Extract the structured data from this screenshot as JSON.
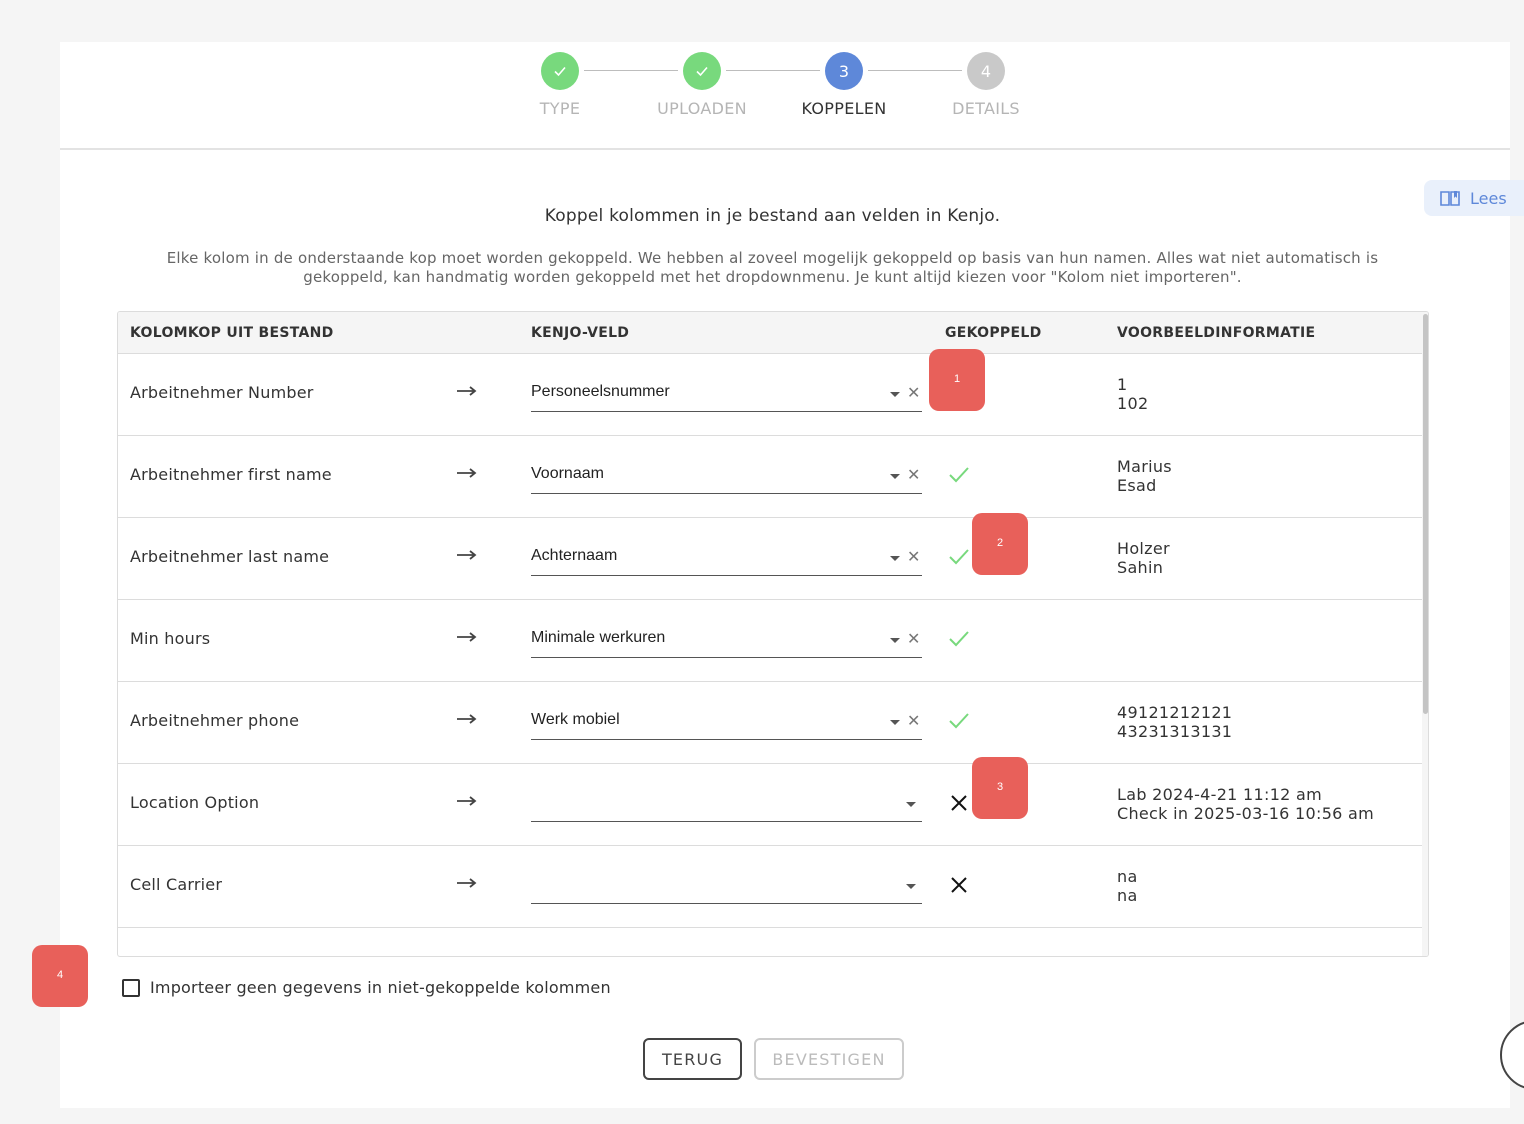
{
  "stepper": {
    "steps": [
      {
        "label": "TYPE",
        "state": "done",
        "number": ""
      },
      {
        "label": "UPLOADEN",
        "state": "done",
        "number": ""
      },
      {
        "label": "KOPPELEN",
        "state": "active",
        "number": "3"
      },
      {
        "label": "DETAILS",
        "state": "pending",
        "number": "4"
      }
    ]
  },
  "help": {
    "label": "Lees"
  },
  "heading": "Koppel kolommen in je bestand aan velden in Kenjo.",
  "intro": "Elke kolom in de onderstaande kop moet worden gekoppeld. We hebben al zoveel mogelijk gekoppeld op basis van hun namen. Alles wat niet automatisch is gekoppeld, kan handmatig worden gekoppeld met het dropdownmenu. Je kunt altijd kiezen voor \"Kolom niet importeren\".",
  "table": {
    "headers": {
      "column": "KOLOMKOP UIT BESTAND",
      "field": "KENJO-VELD",
      "mapped": "GEKOPPELD",
      "example": "VOORBEELDINFORMATIE"
    },
    "rows": [
      {
        "column": "Arbeitnehmer Number",
        "field": "Personeelsnummer",
        "status": "check",
        "example1": "1",
        "example2": "102"
      },
      {
        "column": "Arbeitnehmer first name",
        "field": "Voornaam",
        "status": "check",
        "example1": "Marius",
        "example2": "Esad"
      },
      {
        "column": "Arbeitnehmer last name",
        "field": "Achternaam",
        "status": "check",
        "example1": "Holzer",
        "example2": "Sahin"
      },
      {
        "column": "Min hours",
        "field": "Minimale werkuren",
        "status": "check",
        "example1": "",
        "example2": ""
      },
      {
        "column": "Arbeitnehmer phone",
        "field": "Werk mobiel",
        "status": "check",
        "example1": "49121212121",
        "example2": "43231313131"
      },
      {
        "column": "Location Option",
        "field": "",
        "status": "cross",
        "example1": "Lab 2024-4-21 11:12 am",
        "example2": "Check in 2025-03-16 10:56 am"
      },
      {
        "column": "Cell Carrier",
        "field": "",
        "status": "cross",
        "example1": "na",
        "example2": "na"
      }
    ]
  },
  "checkbox": {
    "label": "Importeer geen gegevens in niet-gekoppelde kolommen",
    "checked": false
  },
  "buttons": {
    "back": "TERUG",
    "confirm": "BEVESTIGEN"
  },
  "markers": [
    "1",
    "2",
    "3",
    "4"
  ],
  "colors": {
    "done": "#78d97d",
    "active": "#5e88d9",
    "pending": "#c9c9c9",
    "marker": "#e8605a",
    "check": "#78d97d"
  }
}
